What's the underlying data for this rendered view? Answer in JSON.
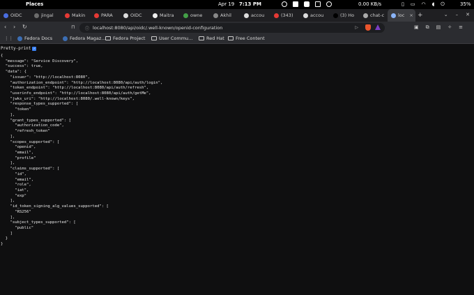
{
  "os": {
    "places": "Places",
    "date": "Apr 19",
    "time": "7:13 PM",
    "net_speed": "0.00 KB/s",
    "battery": "35%"
  },
  "tabs": [
    {
      "label": "OIDC",
      "color": "#4a6ee0",
      "width": 44
    },
    {
      "label": "jingal",
      "color": "#6c6c6c",
      "width": 44
    },
    {
      "label": "Makin",
      "color": "#e53935",
      "width": 42
    },
    {
      "label": "PARA",
      "color": "#e53935",
      "width": 42
    },
    {
      "label": "OIDC",
      "color": "#dddddd",
      "width": 42
    },
    {
      "label": "Maitra",
      "color": "#eeeeee",
      "width": 44
    },
    {
      "label": "owne",
      "color": "#43a047",
      "width": 43
    },
    {
      "label": "Akhil",
      "color": "#888888",
      "width": 44
    },
    {
      "label": "accou",
      "color": "#dddddd",
      "width": 43
    },
    {
      "label": "(343)",
      "color": "#e53935",
      "width": 42
    },
    {
      "label": "accou",
      "color": "#dddddd",
      "width": 43
    },
    {
      "label": "(3) Ho",
      "color": "#000000",
      "width": 43
    },
    {
      "label": "chat-c",
      "color": "#aaaaaa",
      "width": 40
    },
    {
      "label": "loc",
      "color": "#8ab4f8",
      "width": 40,
      "active": true
    }
  ],
  "nav": {
    "url": "localhost:8080/api/oidc/.well-known/openid-configuration"
  },
  "bookmarks": [
    {
      "label": "Fedora Docs",
      "type": "favicon"
    },
    {
      "label": "Fedora Magaz...",
      "type": "favicon"
    },
    {
      "label": "Fedora Project",
      "type": "folder"
    },
    {
      "label": "User Commu...",
      "type": "folder"
    },
    {
      "label": "Red Hat",
      "type": "folder"
    },
    {
      "label": "Free Content",
      "type": "folder"
    }
  ],
  "content": {
    "pretty_print_label": "Pretty-print",
    "json_lines": [
      "{",
      "  \"message\": \"Service Discovery\",",
      "  \"success\": true,",
      "  \"data\": {",
      "    \"issuer\": \"http://localhost:8080\",",
      "    \"authorization_endpoint\": \"http://localhost:8080/api/auth/login\",",
      "    \"token_endpoint\": \"http://localhost:8080/api/auth/refresh\",",
      "    \"userinfo_endpoint\": \"http://localhost:8080/api/auth/getMe\",",
      "    \"jwks_uri\": \"http://localhost:8080/.well-known/keys\",",
      "    \"response_types_supported\": [",
      "      \"token\"",
      "    ],",
      "    \"grant_types_supported\": [",
      "      \"authorization_code\",",
      "      \"refresh_token\"",
      "    ],",
      "    \"scopes_supported\": [",
      "      \"openid\",",
      "      \"email\",",
      "      \"profile\"",
      "    ],",
      "    \"claims_supported\": [",
      "      \"id\",",
      "      \"email\",",
      "      \"role\",",
      "      \"iat\",",
      "      \"exp\"",
      "    ],",
      "    \"id_token_signing_alg_values_supported\": [",
      "      \"RS256\"",
      "    ],",
      "    \"subject_types_supported\": [",
      "      \"public\"",
      "    ]",
      "  }",
      "}"
    ]
  }
}
